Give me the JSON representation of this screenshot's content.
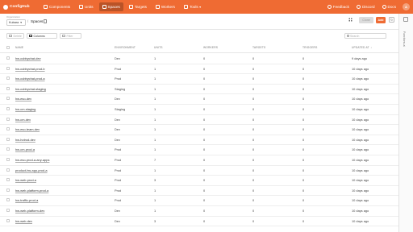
{
  "header": {
    "app_name": "ConfigHub",
    "nav": [
      {
        "label": "Components",
        "icon": "components-icon",
        "active": false
      },
      {
        "label": "Units",
        "icon": "units-icon",
        "active": false
      },
      {
        "label": "Spaces",
        "icon": "spaces-icon",
        "active": true
      },
      {
        "label": "Targets",
        "icon": "targets-icon",
        "active": false
      },
      {
        "label": "Workers",
        "icon": "workers-icon",
        "active": false
      },
      {
        "label": "Tools",
        "icon": "tools-icon",
        "active": false,
        "has_dropdown": true
      }
    ],
    "right": {
      "feedback": "Feedback",
      "discord": "Discord",
      "docs": "Docs",
      "avatar_initial": "A"
    },
    "accent_color": "#ef6b33"
  },
  "breadcrumb": {
    "org_label": "Organization",
    "org_value": "Kubara",
    "separator": "/",
    "current": "Spaces"
  },
  "actions": {
    "clone_label": "Clone",
    "add_label": "Add"
  },
  "side_panel": {
    "label": "Functions-ai"
  },
  "toolbar": {
    "delete_label": "Delete",
    "columns_label": "Columns",
    "filter_label": "Filter",
    "search_placeholder": "Search"
  },
  "table": {
    "headers": {
      "name": "NAME",
      "environment": "ENVIRONMENT",
      "units": "UNITS",
      "workers": "WORKERS",
      "targets": "TARGETS",
      "triggers": "TRIGGERS",
      "updated": "UPDATED AT"
    },
    "rows": [
      {
        "name": "hw-cubbychat-dev",
        "environment": "Dev",
        "units": "1",
        "workers": "0",
        "targets": "0",
        "triggers": "0",
        "updated": "9 days ago"
      },
      {
        "name": "hw-cubbychat-prod-b",
        "environment": "Prod",
        "units": "1",
        "workers": "0",
        "targets": "0",
        "triggers": "0",
        "updated": "10 days ago"
      },
      {
        "name": "hw-cubbychat-prod-a",
        "environment": "Prod",
        "units": "1",
        "workers": "0",
        "targets": "0",
        "triggers": "0",
        "updated": "10 days ago"
      },
      {
        "name": "hw-cubbychat-staging",
        "environment": "Staging",
        "units": "1",
        "workers": "0",
        "targets": "0",
        "triggers": "0",
        "updated": "10 days ago"
      },
      {
        "name": "hw-eso-dev",
        "environment": "Dev",
        "units": "1",
        "workers": "0",
        "targets": "0",
        "triggers": "0",
        "updated": "10 days ago"
      },
      {
        "name": "hw-cm-staging",
        "environment": "Staging",
        "units": "1",
        "workers": "0",
        "targets": "0",
        "triggers": "0",
        "updated": "10 days ago"
      },
      {
        "name": "hw-cm-dev",
        "environment": "Dev",
        "units": "1",
        "workers": "0",
        "targets": "0",
        "triggers": "0",
        "updated": "10 days ago"
      },
      {
        "name": "hw-eso-team-dev",
        "environment": "Dev",
        "units": "1",
        "workers": "0",
        "targets": "0",
        "triggers": "0",
        "updated": "10 days ago"
      },
      {
        "name": "hw-hotrod-dev",
        "environment": "Dev",
        "units": "1",
        "workers": "0",
        "targets": "0",
        "triggers": "0",
        "updated": "10 days ago"
      },
      {
        "name": "hw-cm-prod-a",
        "environment": "Prod",
        "units": "1",
        "workers": "0",
        "targets": "0",
        "triggers": "0",
        "updated": "10 days ago"
      },
      {
        "name": "hw-eso-prod-a-any-apps",
        "environment": "Prod",
        "units": "7",
        "workers": "0",
        "targets": "0",
        "triggers": "0",
        "updated": "10 days ago"
      },
      {
        "name": "product-hw-app-prod-a",
        "environment": "Prod",
        "units": "1",
        "workers": "0",
        "targets": "0",
        "triggers": "0",
        "updated": "10 days ago"
      },
      {
        "name": "hw-web-prod-a",
        "environment": "Prod",
        "units": "3",
        "workers": "0",
        "targets": "0",
        "triggers": "0",
        "updated": "10 days ago"
      },
      {
        "name": "hw-web-platform-prod-a",
        "environment": "Prod",
        "units": "1",
        "workers": "0",
        "targets": "0",
        "triggers": "0",
        "updated": "10 days ago"
      },
      {
        "name": "hw-traffic-prod-a",
        "environment": "Prod",
        "units": "1",
        "workers": "0",
        "targets": "0",
        "triggers": "0",
        "updated": "10 days ago"
      },
      {
        "name": "hw-web-platform-dev",
        "environment": "Dev",
        "units": "1",
        "workers": "0",
        "targets": "0",
        "triggers": "0",
        "updated": "10 days ago"
      },
      {
        "name": "hw-web-dev",
        "environment": "Dev",
        "units": "3",
        "workers": "0",
        "targets": "0",
        "triggers": "0",
        "updated": "10 days ago"
      }
    ]
  }
}
